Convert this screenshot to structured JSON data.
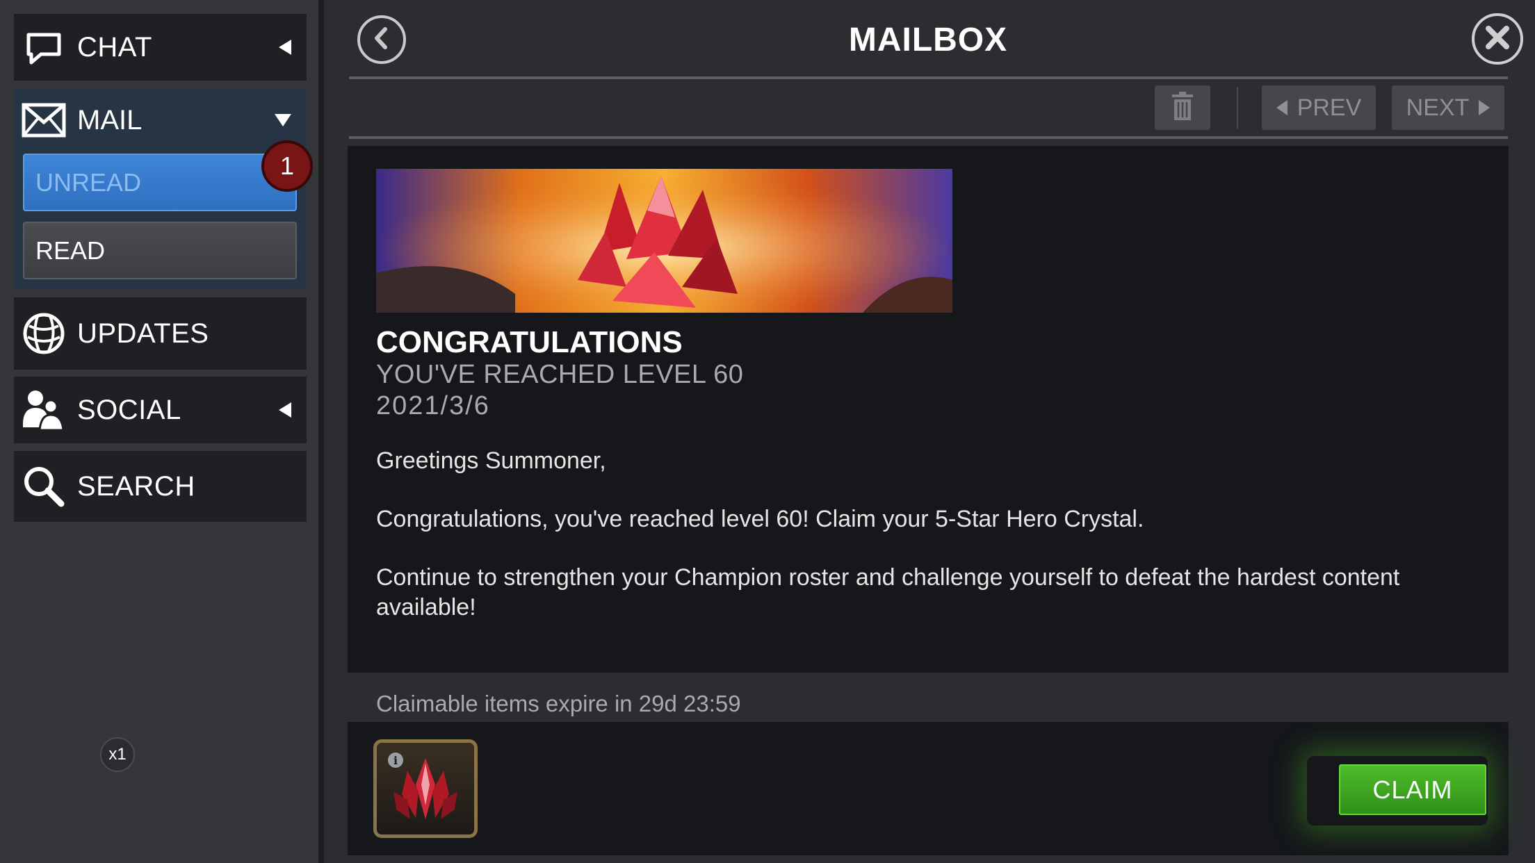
{
  "sidebar": {
    "chat_label": "CHAT",
    "mail_label": "MAIL",
    "unread_label": "UNREAD",
    "unread_count": "1",
    "read_label": "READ",
    "updates_label": "UPDATES",
    "social_label": "SOCIAL",
    "search_label": "SEARCH"
  },
  "header": {
    "title": "MAILBOX"
  },
  "toolbar": {
    "prev_label": "PREV",
    "next_label": "NEXT"
  },
  "message": {
    "title": "CONGRATULATIONS",
    "subtitle": "YOU'VE REACHED LEVEL 60",
    "date": "2021/3/6",
    "greeting": "Greetings Summoner,",
    "paragraph_1": "Congratulations, you've reached level 60! Claim your 5-Star Hero Crystal.",
    "paragraph_2": "Continue to strengthen your Champion roster and challenge yourself to defeat the hardest content available!"
  },
  "rewards": {
    "expire_text": "Claimable items expire in 29d 23:59",
    "item_quantity": "x1",
    "claim_label": "CLAIM"
  },
  "colors": {
    "accent_blue": "#3f86d8",
    "claim_green": "#3fa520",
    "badge_red": "#7a1515"
  }
}
